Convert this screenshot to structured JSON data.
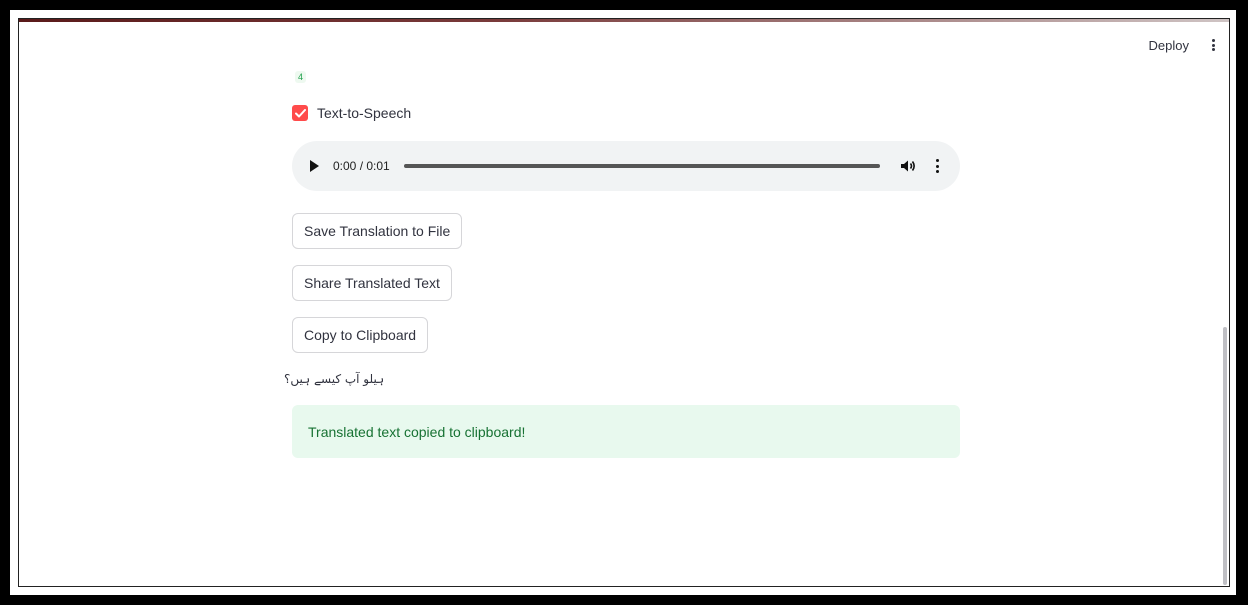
{
  "header": {
    "deploy_label": "Deploy",
    "menu_icon": "kebab-menu-icon"
  },
  "main": {
    "number_badge": "4",
    "tts_checkbox": {
      "label": "Text-to-Speech",
      "checked": true,
      "color": "#ff4b4b"
    },
    "audio_player": {
      "time": "0:00 / 0:01",
      "progress": 0,
      "play_icon": "play-icon",
      "volume_icon": "volume-icon",
      "menu_icon": "more-options-icon"
    },
    "buttons": {
      "save_label": "Save Translation to File",
      "share_label": "Share Translated Text",
      "copy_label": "Copy to Clipboard"
    },
    "translated_text": "ہیلو آپ کیسے ہیں؟",
    "success_message": "Translated text copied to clipboard!",
    "success_bg_color": "#e8f9ee",
    "success_text_color": "#177233"
  }
}
